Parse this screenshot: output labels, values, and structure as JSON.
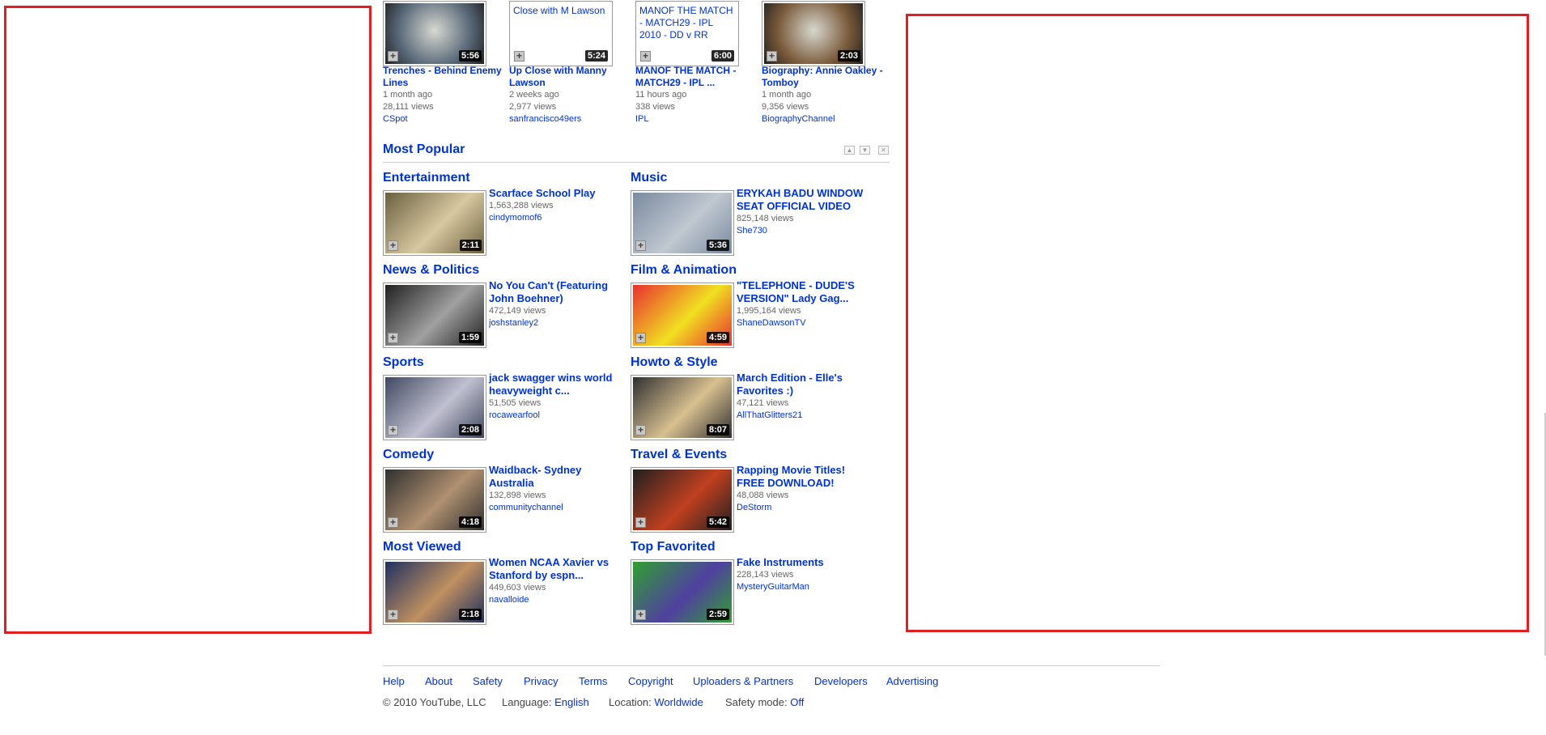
{
  "top_videos": [
    {
      "title": "Trenches - Behind Enemy Lines",
      "duration": "5:56",
      "age": "1 month ago",
      "views": "28,111 views",
      "user": "CSpot",
      "thumb_color": "#5a6a7a"
    },
    {
      "title": "Up Close with Manny Lawson",
      "duration": "5:24",
      "age": "2 weeks ago",
      "views": "2,977 views",
      "user": "sanfrancisco49ers",
      "broken_text": "Close with M Lawson"
    },
    {
      "title": "MANOF THE MATCH - MATCH29 - IPL ...",
      "duration": "6:00",
      "age": "11 hours ago",
      "views": "338 views",
      "user": "IPL",
      "broken_text": "MANOF THE MATCH - MATCH29 - IPL 2010 - DD v RR"
    },
    {
      "title": "Biography: Annie Oakley - Tomboy",
      "duration": "2:03",
      "age": "1 month ago",
      "views": "9,356 views",
      "user": "BiographyChannel",
      "thumb_color": "#7a5a3a"
    }
  ],
  "most_popular": {
    "heading": "Most Popular",
    "categories": [
      {
        "name": "Entertainment",
        "title": "Scarface School Play",
        "views": "1,563,288 views",
        "user": "cindymomof6",
        "duration": "2:11",
        "colors": [
          "#6a6040",
          "#d8c8a0"
        ]
      },
      {
        "name": "Music",
        "title": "ERYKAH BADU WINDOW SEAT OFFICIAL VIDEO",
        "views": "825,148 views",
        "user": "She730",
        "duration": "5:36",
        "colors": [
          "#7a8aa0",
          "#c0c8d0"
        ]
      },
      {
        "name": "News & Politics",
        "title": "No You Can't (Featuring John Boehner)",
        "views": "472,149 views",
        "user": "joshstanley2",
        "duration": "1:59",
        "colors": [
          "#202020",
          "#a0a0a0"
        ]
      },
      {
        "name": "Film & Animation",
        "title": "\"TELEPHONE - DUDE'S VERSION\" Lady Gag...",
        "views": "1,995,164 views",
        "user": "ShaneDawsonTV",
        "duration": "4:59",
        "colors": [
          "#e83030",
          "#f0e020"
        ]
      },
      {
        "name": "Sports",
        "title": "jack swagger wins world heavyweight c...",
        "views": "51,505 views",
        "user": "rocawearfool",
        "duration": "2:08",
        "colors": [
          "#404860",
          "#c0c0d0"
        ]
      },
      {
        "name": "Howto & Style",
        "title": "March Edition - Elle's Favorites :)",
        "views": "47,121 views",
        "user": "AllThatGlitters21",
        "duration": "8:07",
        "colors": [
          "#303030",
          "#d8c090"
        ]
      },
      {
        "name": "Comedy",
        "title": "Waidback- Sydney Australia",
        "views": "132,898 views",
        "user": "communitychannel",
        "duration": "4:18",
        "colors": [
          "#303030",
          "#b09070"
        ]
      },
      {
        "name": "Travel & Events",
        "title": "Rapping Movie Titles! FREE DOWNLOAD!",
        "views": "48,088 views",
        "user": "DeStorm",
        "duration": "5:42",
        "colors": [
          "#202020",
          "#c04020"
        ]
      },
      {
        "name": "Most Viewed",
        "title": "Women NCAA Xavier vs Stanford by espn...",
        "views": "449,603 views",
        "user": "navalloide",
        "duration": "2:18",
        "colors": [
          "#203060",
          "#c09060"
        ]
      },
      {
        "name": "Top Favorited",
        "title": "Fake Instruments",
        "views": "228,143 views",
        "user": "MysteryGuitarMan",
        "duration": "2:59",
        "colors": [
          "#30a030",
          "#5040a0"
        ]
      }
    ]
  },
  "footer": {
    "links": [
      "Help",
      "About",
      "Safety",
      "Privacy",
      "Terms",
      "Copyright",
      "Uploaders & Partners",
      "Developers",
      "Advertising"
    ],
    "copyright": "© 2010 YouTube, LLC",
    "language_label": "Language:",
    "language_value": "English",
    "location_label": "Location:",
    "location_value": "Worldwide",
    "safety_label": "Safety mode:",
    "safety_value": "Off"
  }
}
